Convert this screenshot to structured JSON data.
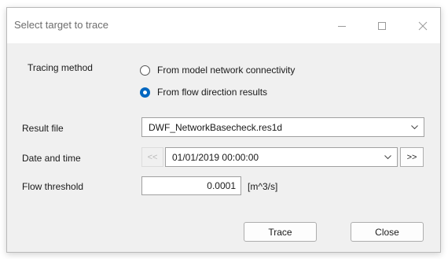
{
  "window": {
    "title": "Select target to trace"
  },
  "tracing": {
    "label": "Tracing method",
    "options": [
      {
        "label": "From model network connectivity",
        "selected": false
      },
      {
        "label": "From flow direction results",
        "selected": true
      }
    ]
  },
  "result_file": {
    "label": "Result file",
    "value": "DWF_NetworkBasecheck.res1d"
  },
  "date_time": {
    "label": "Date and time",
    "prev_label": "<<",
    "value": "01/01/2019 00:00:00",
    "next_label": ">>"
  },
  "flow_threshold": {
    "label": "Flow threshold",
    "value": "0.0001",
    "unit": "[m^3/s]"
  },
  "buttons": {
    "trace": "Trace",
    "close": "Close"
  },
  "colors": {
    "accent": "#0067c0",
    "dialog_bg": "#f0f0f0"
  }
}
